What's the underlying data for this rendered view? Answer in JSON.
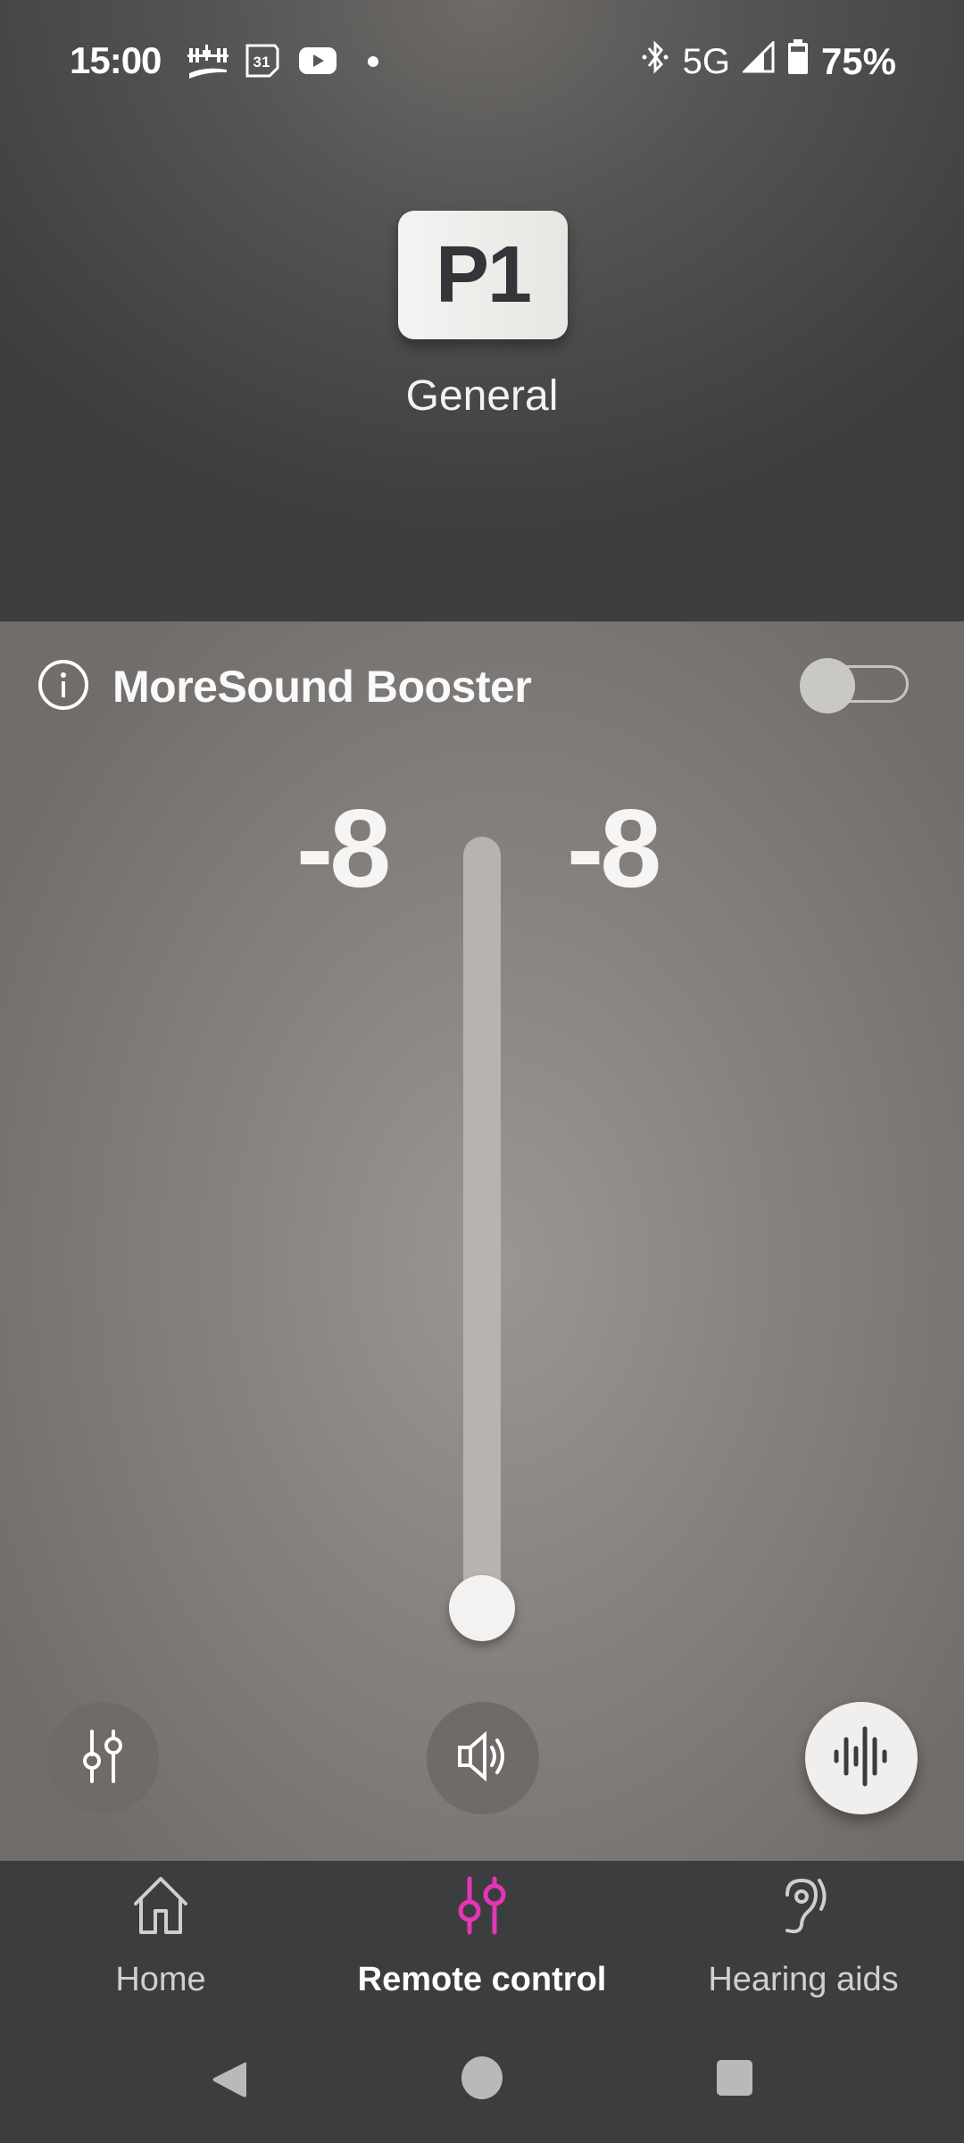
{
  "status_bar": {
    "time": "15:00",
    "left_icons": [
      "space-station-icon",
      "calendar-icon",
      "youtube-icon",
      "notification-dot-icon"
    ],
    "calendar_day": "31",
    "network": "5G",
    "battery": "75%",
    "right_icons": [
      "bluetooth-icon",
      "signal-icon",
      "battery-icon"
    ]
  },
  "program": {
    "badge": "P1",
    "name": "General"
  },
  "booster": {
    "label": "MoreSound Booster",
    "enabled": false
  },
  "volume": {
    "left_value": "-8",
    "right_value": "-8",
    "slider_level": 0.0
  },
  "controls": {
    "equalizer_button": "equalizer-icon",
    "volume_button": "speaker-icon",
    "sound_button": "sound-wave-icon"
  },
  "nav": {
    "items": [
      {
        "label": "Home",
        "icon": "home-icon",
        "active": false
      },
      {
        "label": "Remote control",
        "icon": "sliders-icon",
        "active": true
      },
      {
        "label": "Hearing aids",
        "icon": "ear-icon",
        "active": false
      }
    ]
  },
  "colors": {
    "accent": "#e535b4",
    "nav_background": "#3c3d3f"
  }
}
